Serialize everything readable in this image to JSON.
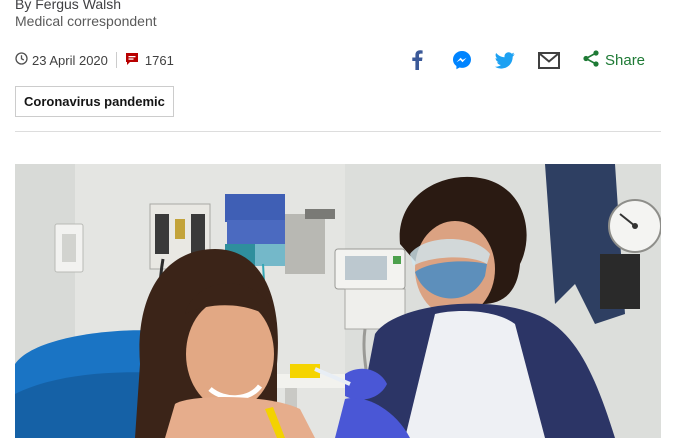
{
  "byline": {
    "author": "By Fergus Walsh",
    "role": "Medical correspondent"
  },
  "meta": {
    "date": "23 April 2020",
    "comment_count": "1761",
    "clock_icon": "clock-icon",
    "comment_icon": "comment-icon",
    "comment_icon_color": "#b80000"
  },
  "share": {
    "label": "Share",
    "accent": "#1e7a35",
    "facebook_color": "#3b5998",
    "messenger_color": "#0084ff",
    "twitter_color": "#1da1f2",
    "email_color": "#404040",
    "icons": [
      "facebook-icon",
      "messenger-icon",
      "twitter-icon",
      "email-icon",
      "share-icon"
    ]
  },
  "topic_tag": {
    "label": "Coronavirus pandemic"
  },
  "hero_image": {
    "subject": "nurse-vaccinating-volunteer-photo"
  }
}
